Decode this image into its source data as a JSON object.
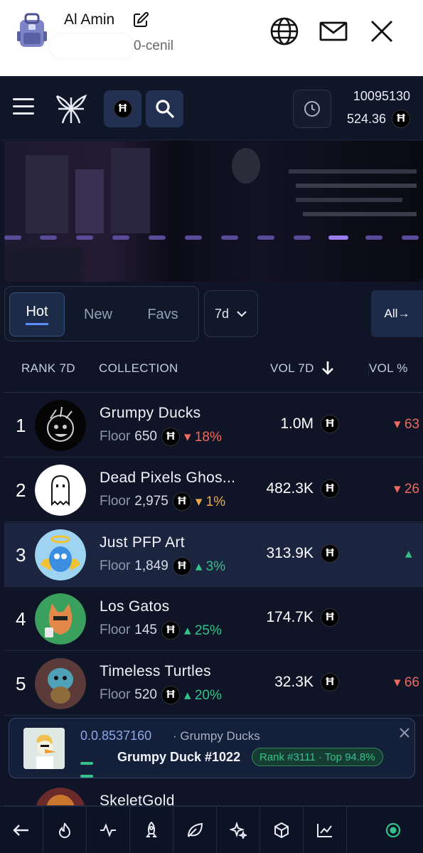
{
  "account": {
    "name": "Al Amin",
    "id_suffix": "0-cenil"
  },
  "header": {
    "wallet_number": "10095130",
    "wallet_balance": "524.36",
    "currency_symbol": "Ħ"
  },
  "filters": {
    "tabs": [
      {
        "label": "Hot",
        "active": true
      },
      {
        "label": "New",
        "active": false
      },
      {
        "label": "Favs",
        "active": false
      }
    ],
    "period": "7d",
    "all_label": "All→"
  },
  "table": {
    "columns": [
      "RANK 7D",
      "COLLECTION",
      "VOL 7D",
      "VOL %"
    ],
    "rows": [
      {
        "rank": "1",
        "name": "Grumpy Ducks",
        "floor_label": "Floor",
        "floor": "650",
        "change": "18%",
        "change_dir": "down",
        "volume": "1.0M",
        "vol_pct": "63"
      },
      {
        "rank": "2",
        "name": "Dead Pixels Ghos...",
        "floor_label": "Floor",
        "floor": "2,975",
        "change": "1%",
        "change_dir": "flat",
        "volume": "482.3K",
        "vol_pct": "26"
      },
      {
        "rank": "3",
        "name": "Just PFP Art",
        "floor_label": "Floor",
        "floor": "1,849",
        "change": "3%",
        "change_dir": "up",
        "volume": "313.9K",
        "vol_pct": ""
      },
      {
        "rank": "4",
        "name": "Los Gatos",
        "floor_label": "Floor",
        "floor": "145",
        "change": "25%",
        "change_dir": "up",
        "volume": "174.7K",
        "vol_pct": ""
      },
      {
        "rank": "5",
        "name": "Timeless Turtles",
        "floor_label": "Floor",
        "floor": "520",
        "change": "20%",
        "change_dir": "up",
        "volume": "32.3K",
        "vol_pct": "66"
      },
      {
        "rank": "",
        "name": "SkeletGold",
        "floor_label": "",
        "floor": "",
        "change": "",
        "change_dir": "",
        "volume": "",
        "vol_pct": ""
      }
    ]
  },
  "toast": {
    "address": "0.0.8537160",
    "collection": "· Grumpy Ducks",
    "nft_name": "Grumpy Duck #1022",
    "badge": "Rank #3111 · Top 94.8%"
  },
  "bottom_nav": [
    "back-arrow-icon",
    "fire-icon",
    "activity-icon",
    "rocket-icon",
    "leaf-icon",
    "sparkles-icon",
    "cube-icon",
    "chart-line-icon",
    "live-dot-icon"
  ],
  "colors": {
    "background": "#0f1526",
    "accent": "#5b8dff",
    "down": "#f06a5f",
    "up": "#35c18a",
    "flat": "#f0a94a"
  }
}
